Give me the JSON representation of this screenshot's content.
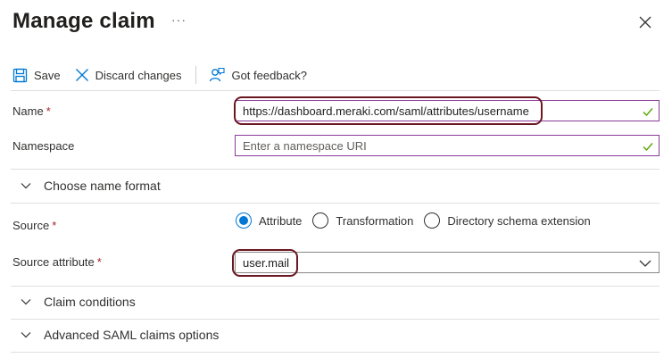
{
  "header": {
    "title": "Manage claim",
    "more": "···"
  },
  "toolbar": {
    "save_label": "Save",
    "discard_label": "Discard changes",
    "feedback_label": "Got feedback?"
  },
  "form": {
    "name": {
      "label": "Name",
      "required_mark": "*",
      "value": "https://dashboard.meraki.com/saml/attributes/username"
    },
    "namespace": {
      "label": "Namespace",
      "placeholder": "Enter a namespace URI"
    },
    "name_format_section": "Choose name format",
    "source": {
      "label": "Source",
      "required_mark": "*",
      "options": [
        "Attribute",
        "Transformation",
        "Directory schema extension"
      ],
      "selected": "Attribute"
    },
    "source_attribute": {
      "label": "Source attribute",
      "required_mark": "*",
      "value": "user.mail"
    },
    "claim_conditions_section": "Claim conditions",
    "advanced_section": "Advanced SAML claims options"
  },
  "colors": {
    "accent": "#0078d4",
    "valid_check": "#57a300",
    "required": "#a4262c",
    "highlight": "#6b1721"
  }
}
